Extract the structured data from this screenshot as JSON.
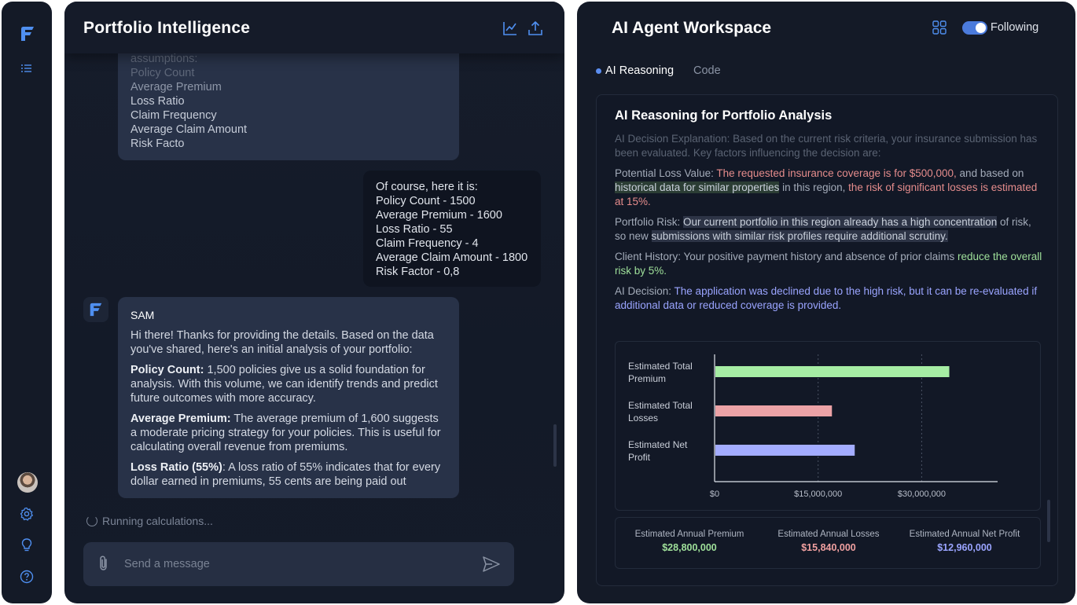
{
  "sidebar": {
    "logo_icon": "brand-logo-icon",
    "items": [
      {
        "name": "list-icon"
      },
      {
        "name": "settings-icon"
      },
      {
        "name": "lightbulb-icon"
      },
      {
        "name": "help-icon"
      }
    ]
  },
  "chat": {
    "title": "Portfolio Intelligence",
    "header_icons": [
      "chart-icon",
      "export-icon"
    ],
    "user_message_lines": [
      "assumptions:",
      "Policy Count",
      "Average Premium",
      "Loss Ratio",
      "Claim Frequency",
      "Average Claim Amount",
      "Risk Facto"
    ],
    "reply_lines": [
      "Of course, here it is:",
      "Policy Count - 1500",
      "Average Premium - 1600",
      "Loss Ratio - 55",
      "Claim Frequency - 4",
      "Average Claim Amount - 1800",
      "Risk Factor - 0,8"
    ],
    "bot": {
      "sender": "SAM",
      "intro": "Hi there! Thanks for providing the details. Based on the data you've shared, here's an initial analysis of your portfolio:",
      "p1_label": "Policy Count:",
      "p1_text": " 1,500 policies give us a solid foundation for analysis. With this volume, we can identify trends and predict future outcomes with more accuracy.",
      "p2_label": "Average Premium:",
      "p2_text": " The average premium of 1,600 suggests a moderate pricing strategy for your policies. This is useful for calculating overall revenue from premiums.",
      "p3_label": "Loss Ratio (55%)",
      "p3_text": ": A loss ratio of 55% indicates that for every dollar earned in premiums, 55 cents are being paid out"
    },
    "status": "Running calculations...",
    "composer_placeholder": "Send a message"
  },
  "workspace": {
    "title": "AI Agent Workspace",
    "following_label": "Following",
    "following_on": true,
    "tabs": [
      {
        "label": "AI Reasoning",
        "active": true
      },
      {
        "label": "Code",
        "active": false
      }
    ],
    "card_title": "AI Reasoning for Portfolio Analysis",
    "intro_fade": "AI Decision Explanation: Based on the current risk criteria, your insurance submission has been evaluated. Key factors influencing the decision are:",
    "loss_label": "Potential Loss Value: ",
    "loss_red1": "The requested insurance coverage is for $500,000,",
    "loss_mid": " and based on ",
    "loss_hl": "historical data for similar properties",
    "loss_tail": " in this region, ",
    "loss_red2": "the risk of significant losses is estimated at 15%.",
    "risk_label": "Portfolio Risk: ",
    "risk_hl1": "Our current portfolio in this region already has a high concentration",
    "risk_mid": " of risk, so new ",
    "risk_hl2": "submissions with similar risk profiles require additional scrutiny.",
    "client_label": "Client History: ",
    "client_text": "Your positive payment history and absence of prior claims ",
    "client_green": "reduce the overall risk by 5%.",
    "decision_label": "AI Decision: ",
    "decision_blue": "The application was declined due to the high risk, but it can be re-evaluated if additional data or reduced coverage is provided.",
    "summary": [
      {
        "label": "Estimated Annual Premium",
        "value": "$28,800,000",
        "color": "#9fe09a"
      },
      {
        "label": "Estimated Annual Losses",
        "value": "$15,840,000",
        "color": "#f0a0a0"
      },
      {
        "label": "Estimated Annual Net Profit",
        "value": "$12,960,000",
        "color": "#9aa4ff"
      }
    ]
  },
  "chart_data": {
    "type": "bar",
    "orientation": "horizontal",
    "categories": [
      [
        "Estimated Total",
        "Premium"
      ],
      [
        "Estimated Total",
        "Losses"
      ],
      [
        "Estimated Net",
        "Profit"
      ]
    ],
    "values": [
      34000000,
      17000000,
      20300000
    ],
    "colors": [
      "#a6eda4",
      "#eba2a6",
      "#a3acff"
    ],
    "xlim": [
      0,
      41000000
    ],
    "xticks": [
      0,
      15000000,
      30000000
    ],
    "xtick_labels": [
      "$0",
      "$15,000,000",
      "$30,000,000"
    ],
    "grid": "vertical-dotted"
  }
}
